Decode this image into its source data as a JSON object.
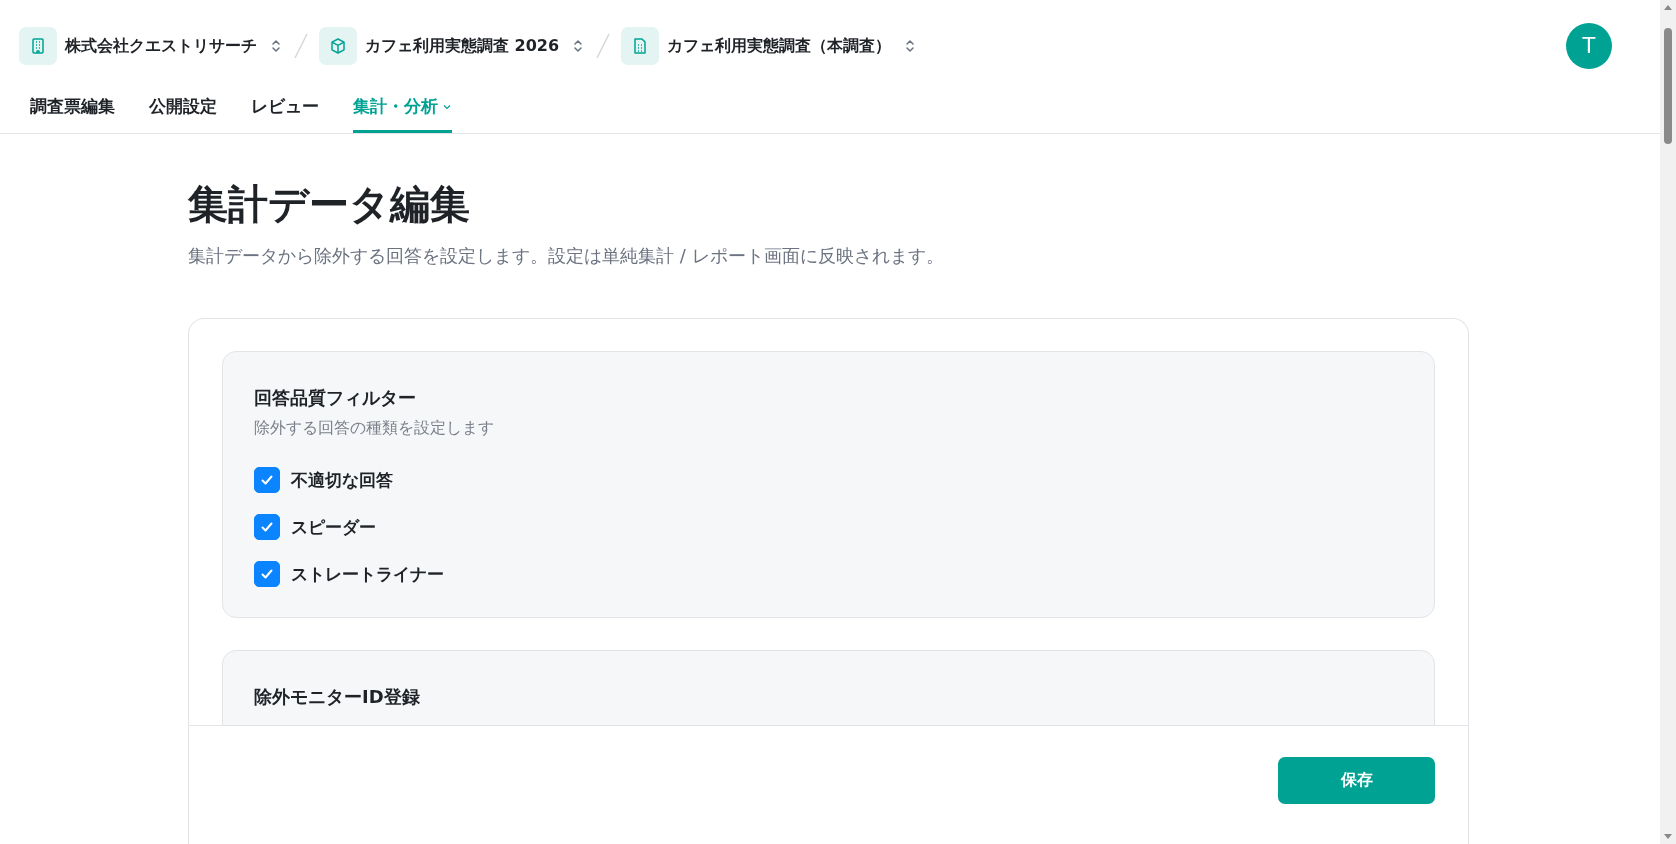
{
  "breadcrumbs": [
    {
      "kind": "organization",
      "label": "株式会社クエストリサーチ"
    },
    {
      "kind": "project",
      "label": "カフェ利用実態調査 2026"
    },
    {
      "kind": "survey",
      "label": "カフェ利用実態調査（本調査）"
    }
  ],
  "avatar": {
    "initial": "T"
  },
  "tabs": [
    {
      "label": "調査票編集",
      "selected": false,
      "dropdown": false
    },
    {
      "label": "公開設定",
      "selected": false,
      "dropdown": false
    },
    {
      "label": "レビュー",
      "selected": false,
      "dropdown": false
    },
    {
      "label": "集計・分析",
      "selected": true,
      "dropdown": true
    }
  ],
  "page": {
    "title": "集計データ編集",
    "description": "集計データから除外する回答を設定します。設定は単純集計 / レポート画面に反映されます。"
  },
  "sections": [
    {
      "title": "回答品質フィルター",
      "description": "除外する回答の種類を設定します",
      "options": [
        {
          "label": "不適切な回答",
          "checked": true
        },
        {
          "label": "スピーダー",
          "checked": true
        },
        {
          "label": "ストレートライナー",
          "checked": true
        }
      ]
    },
    {
      "title": "除外モニターID登録"
    }
  ],
  "footer": {
    "save": "保存"
  }
}
